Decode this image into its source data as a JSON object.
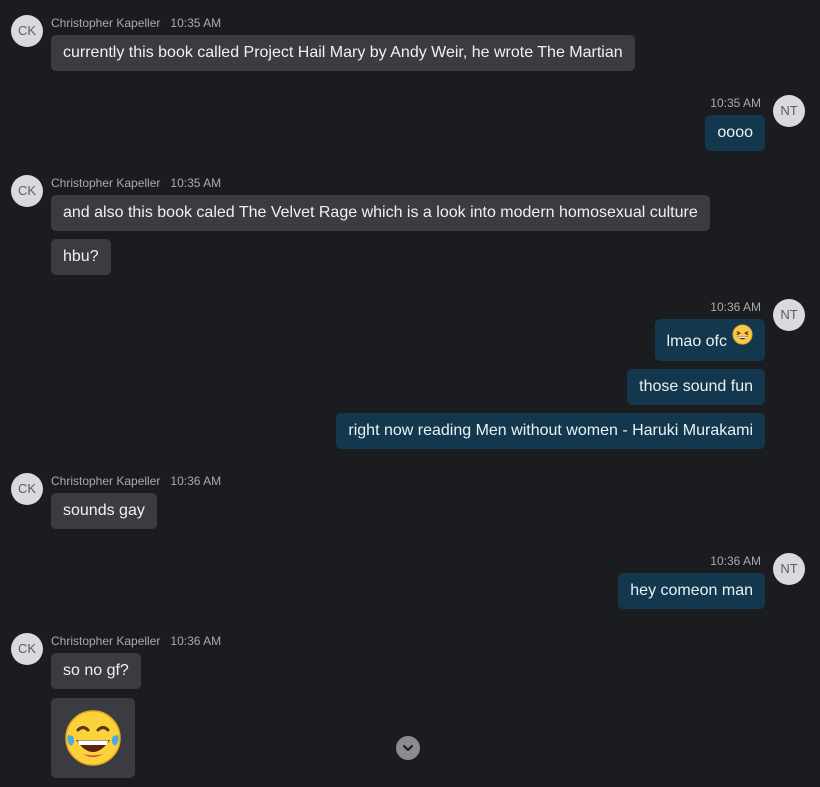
{
  "users": {
    "ck": {
      "initials": "CK",
      "name": "Christopher Kapeller"
    },
    "nt": {
      "initials": "NT"
    }
  },
  "messages": [
    {
      "sender": "ck",
      "time": "10:35 AM",
      "texts": [
        "currently this book called Project Hail Mary by Andy Weir, he wrote The Martian"
      ]
    },
    {
      "sender": "nt",
      "time": "10:35 AM",
      "texts": [
        "oooo"
      ]
    },
    {
      "sender": "ck",
      "time": "10:35 AM",
      "texts": [
        "and also this book caled The Velvet Rage which is a look into modern homosexual culture",
        "hbu?"
      ]
    },
    {
      "sender": "nt",
      "time": "10:36 AM",
      "texts": [
        "lmao ofc",
        "those sound fun",
        "right now reading Men without women - Haruki Murakami"
      ]
    },
    {
      "sender": "ck",
      "time": "10:36 AM",
      "texts": [
        "sounds gay"
      ]
    },
    {
      "sender": "nt",
      "time": "10:36 AM",
      "texts": [
        "hey comeon man"
      ]
    },
    {
      "sender": "ck",
      "time": "10:36 AM",
      "texts": [
        "so no gf?"
      ]
    }
  ],
  "emoji": {
    "inline": "grinning-squinting-face",
    "sticker": "face-with-tears-of-joy"
  },
  "colors": {
    "background": "#1b1c20",
    "incoming_bubble": "#3a3c41",
    "outgoing_bubble": "#13384d",
    "avatar": "#d9dadb"
  }
}
